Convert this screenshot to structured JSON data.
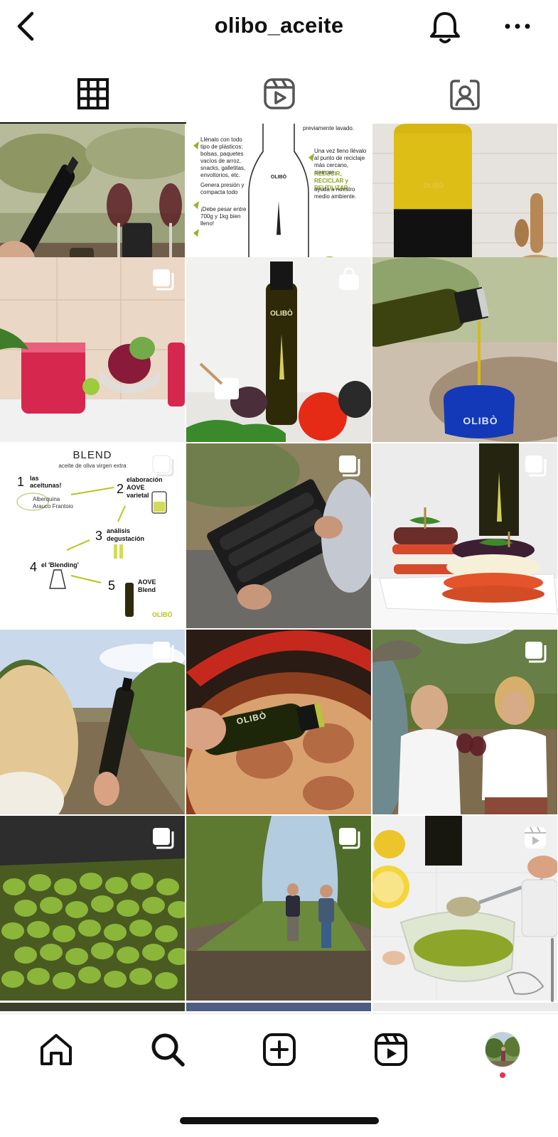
{
  "header": {
    "username": "olibo_aceite",
    "back_icon": "chevron-left-icon",
    "notifications_icon": "bell-icon",
    "more_icon": "more-horizontal-icon"
  },
  "tabs": [
    {
      "name": "posts",
      "icon": "grid-icon",
      "active": true
    },
    {
      "name": "reels",
      "icon": "reels-icon",
      "active": false
    },
    {
      "name": "tagged",
      "icon": "tagged-person-icon",
      "active": false
    }
  ],
  "grid": {
    "tiles": [
      {
        "subject": "olive oil bottle with wine glasses outdoors",
        "badge": null
      },
      {
        "subject": "recycling infographic",
        "badge": null,
        "text": {
          "left1": "Llénalo con todo tipo de plásticos: bolsas, paquetes vacíos de arroz, snacks, galletitas, envoltorios, etc.",
          "left2": "Genera presión y compacta todo",
          "left3": "¡Debe pesar entre 700g y 1kg bien lleno!",
          "right0": "previamente lavado.",
          "right1": "Una vez lleno llévalo al punto de reciclaje más cercano, siempre",
          "right_highlight": "REDUCIR, RECICLAR y REUTILIZAR",
          "right2": "ayuda a nuestro medio ambiente.",
          "bottle_label": "OLIBÒ"
        }
      },
      {
        "subject": "large olive oil jug in kitchen",
        "badge": null,
        "label": "OLIBÒ"
      },
      {
        "subject": "beet smoothie glasses",
        "badge": "carousel"
      },
      {
        "subject": "olive oil bottle with vegetables",
        "badge": "shopping",
        "label": "OLIBÒ"
      },
      {
        "subject": "pouring olive oil into blue glass",
        "badge": null,
        "label": "OLIBÒ"
      },
      {
        "subject": "blend infographic",
        "badge": "carousel",
        "text": {
          "title": "BLEND",
          "subtitle": "aceite de oliva virgen extra",
          "s1": "las aceitunas!",
          "s1_items": "Alberquina Arauco Frantoio",
          "s2": "elaboración AOVE varietal",
          "s3": "análisis degustación",
          "s4": "el 'Blending'",
          "s5": "AOVE Blend",
          "brand": "OLIBÒ",
          "n1": "1",
          "n2": "2",
          "n3": "3",
          "n4": "4",
          "n5": "5"
        }
      },
      {
        "subject": "gift box with three bottles",
        "badge": "carousel"
      },
      {
        "subject": "eggplant stacks appetizer",
        "badge": "carousel"
      },
      {
        "subject": "woman holding bottle in olive grove",
        "badge": "carousel"
      },
      {
        "subject": "pouring oil over osso buco",
        "badge": null,
        "label": "OLIBÒ"
      },
      {
        "subject": "people toasting with wine in grove",
        "badge": "carousel"
      },
      {
        "subject": "crate of green olives",
        "badge": "carousel"
      },
      {
        "subject": "two men walking in olive grove",
        "badge": "carousel"
      },
      {
        "subject": "spoon with olive oil dressing",
        "badge": "reel"
      }
    ]
  },
  "bottom_nav": [
    {
      "name": "home",
      "icon": "home-icon"
    },
    {
      "name": "search",
      "icon": "search-icon"
    },
    {
      "name": "create",
      "icon": "plus-square-icon"
    },
    {
      "name": "reels",
      "icon": "reels-icon"
    },
    {
      "name": "profile",
      "icon": "profile-avatar",
      "has_notification_dot": true
    }
  ],
  "colors": {
    "notification_dot": "#e8344e",
    "oil_green": "#b7a21a",
    "text": "#111111"
  }
}
